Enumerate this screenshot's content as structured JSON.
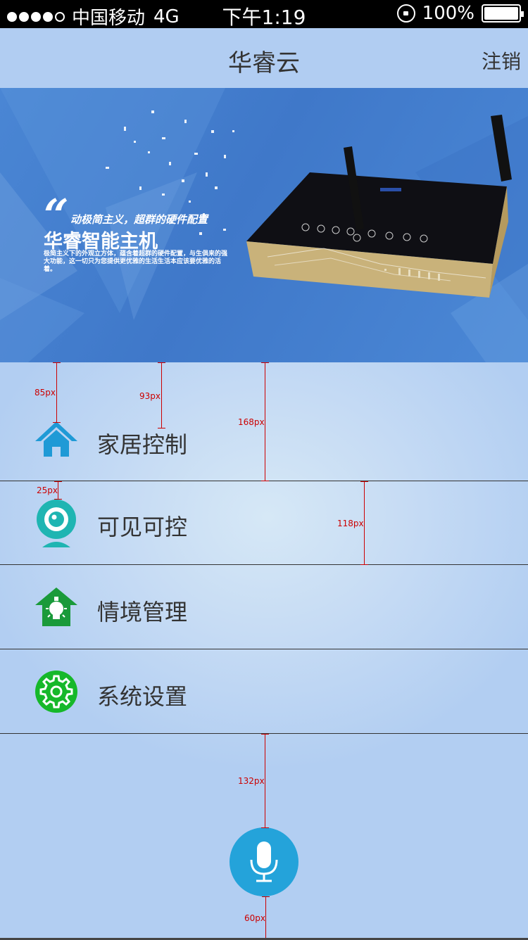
{
  "status_bar": {
    "carrier": "中国移动",
    "network": "4G",
    "time": "下午1:19",
    "battery": "100%",
    "signal_bars": 4,
    "signal_max": 5,
    "battery_level": 1.0
  },
  "header": {
    "title": "华睿云",
    "logout_label": "注销"
  },
  "banner": {
    "slogan": "动极简主义，超群的硬件配置",
    "product_name": "华睿智能主机",
    "description": "极简主义下的外观立方体，蕴含着超群的硬件配置，与生俱来的强大功能，这一切只为您提供更优雅的生活生活本应该要优雅的活着。"
  },
  "menu": {
    "items": [
      {
        "label": "家居控制",
        "icon": "home-icon",
        "color": "#1f9ad6"
      },
      {
        "label": "可见可控",
        "icon": "camera-icon",
        "color": "#1fb5b2"
      },
      {
        "label": "情境管理",
        "icon": "scene-bulb-icon",
        "color": "#1a9a3a"
      },
      {
        "label": "系统设置",
        "icon": "gear-icon",
        "color": "#16b82a"
      }
    ]
  },
  "mic": {
    "icon": "microphone-icon",
    "color": "#24a3da"
  },
  "annotations": {
    "a1": "85px",
    "a2": "93px",
    "a3": "168px",
    "a4": "25px",
    "a5": "118px",
    "a6": "132px",
    "a7": "60px"
  }
}
